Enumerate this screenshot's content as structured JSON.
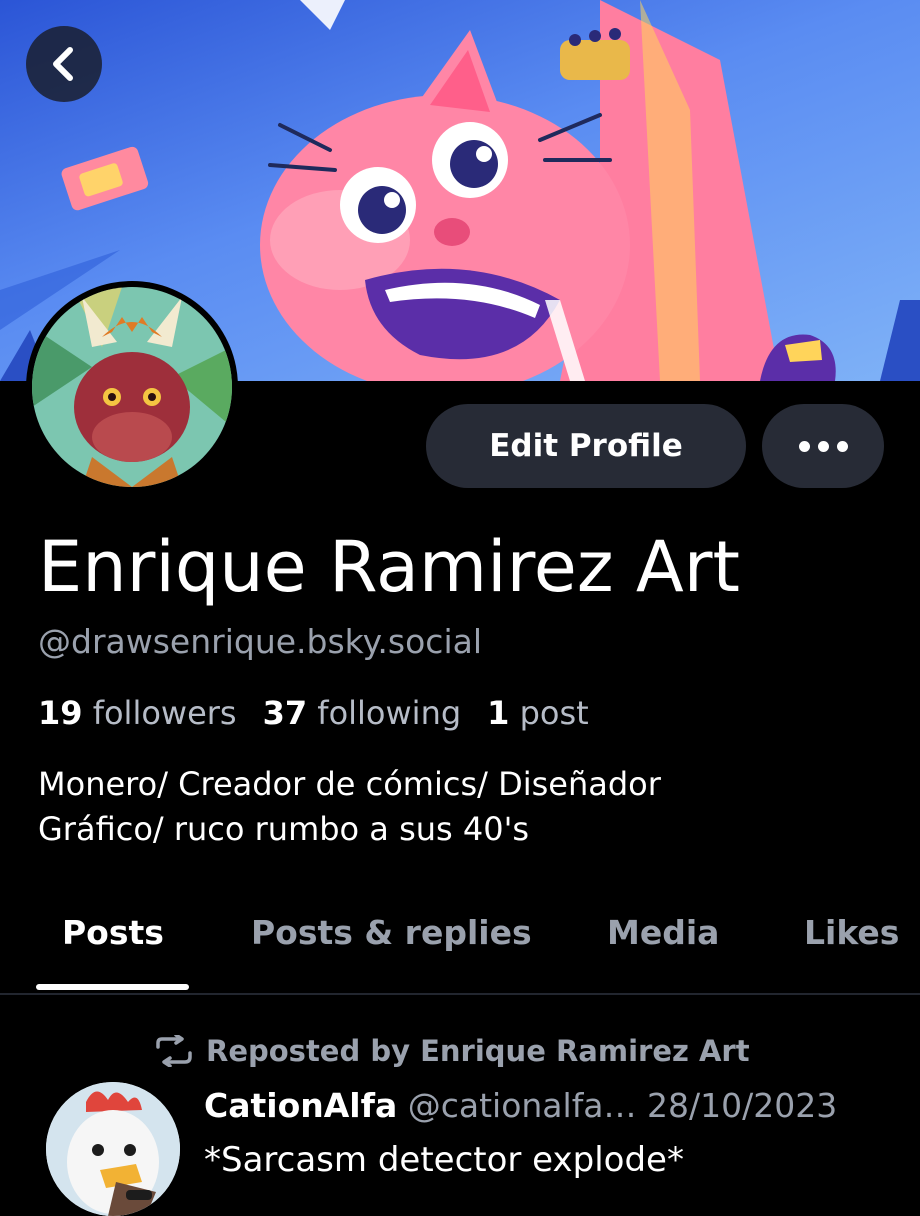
{
  "header": {
    "back_icon": "chevron-left-icon",
    "banner_alt": "profile banner illustration"
  },
  "actions": {
    "edit_profile_label": "Edit Profile",
    "more_icon": "ellipsis-icon"
  },
  "profile": {
    "display_name": "Enrique Ramirez Art",
    "handle": "@drawsenrique.bsky.social",
    "followers_count": "19",
    "followers_label": "followers",
    "following_count": "37",
    "following_label": "following",
    "posts_count": "1",
    "posts_label": "post",
    "bio_line1": "Monero/ Creador de cómics/ Diseñador",
    "bio_line2": "Gráfico/ ruco rumbo a sus 40's"
  },
  "tabs": [
    {
      "label": "Posts",
      "active": true
    },
    {
      "label": "Posts & replies",
      "active": false
    },
    {
      "label": "Media",
      "active": false
    },
    {
      "label": "Likes",
      "active": false
    }
  ],
  "feed": {
    "repost_label": "Reposted by Enrique Ramirez Art",
    "repost_icon": "repost-icon",
    "post": {
      "author": "CationAlfa",
      "handle": "@cationalfa…",
      "date": "28/10/2023",
      "text": "*Sarcasm detector explode*"
    }
  },
  "colors": {
    "background": "#000000",
    "button_bg": "#272b36",
    "muted_text": "#9aa1ad",
    "banner_blue": "#4f7fe8"
  }
}
